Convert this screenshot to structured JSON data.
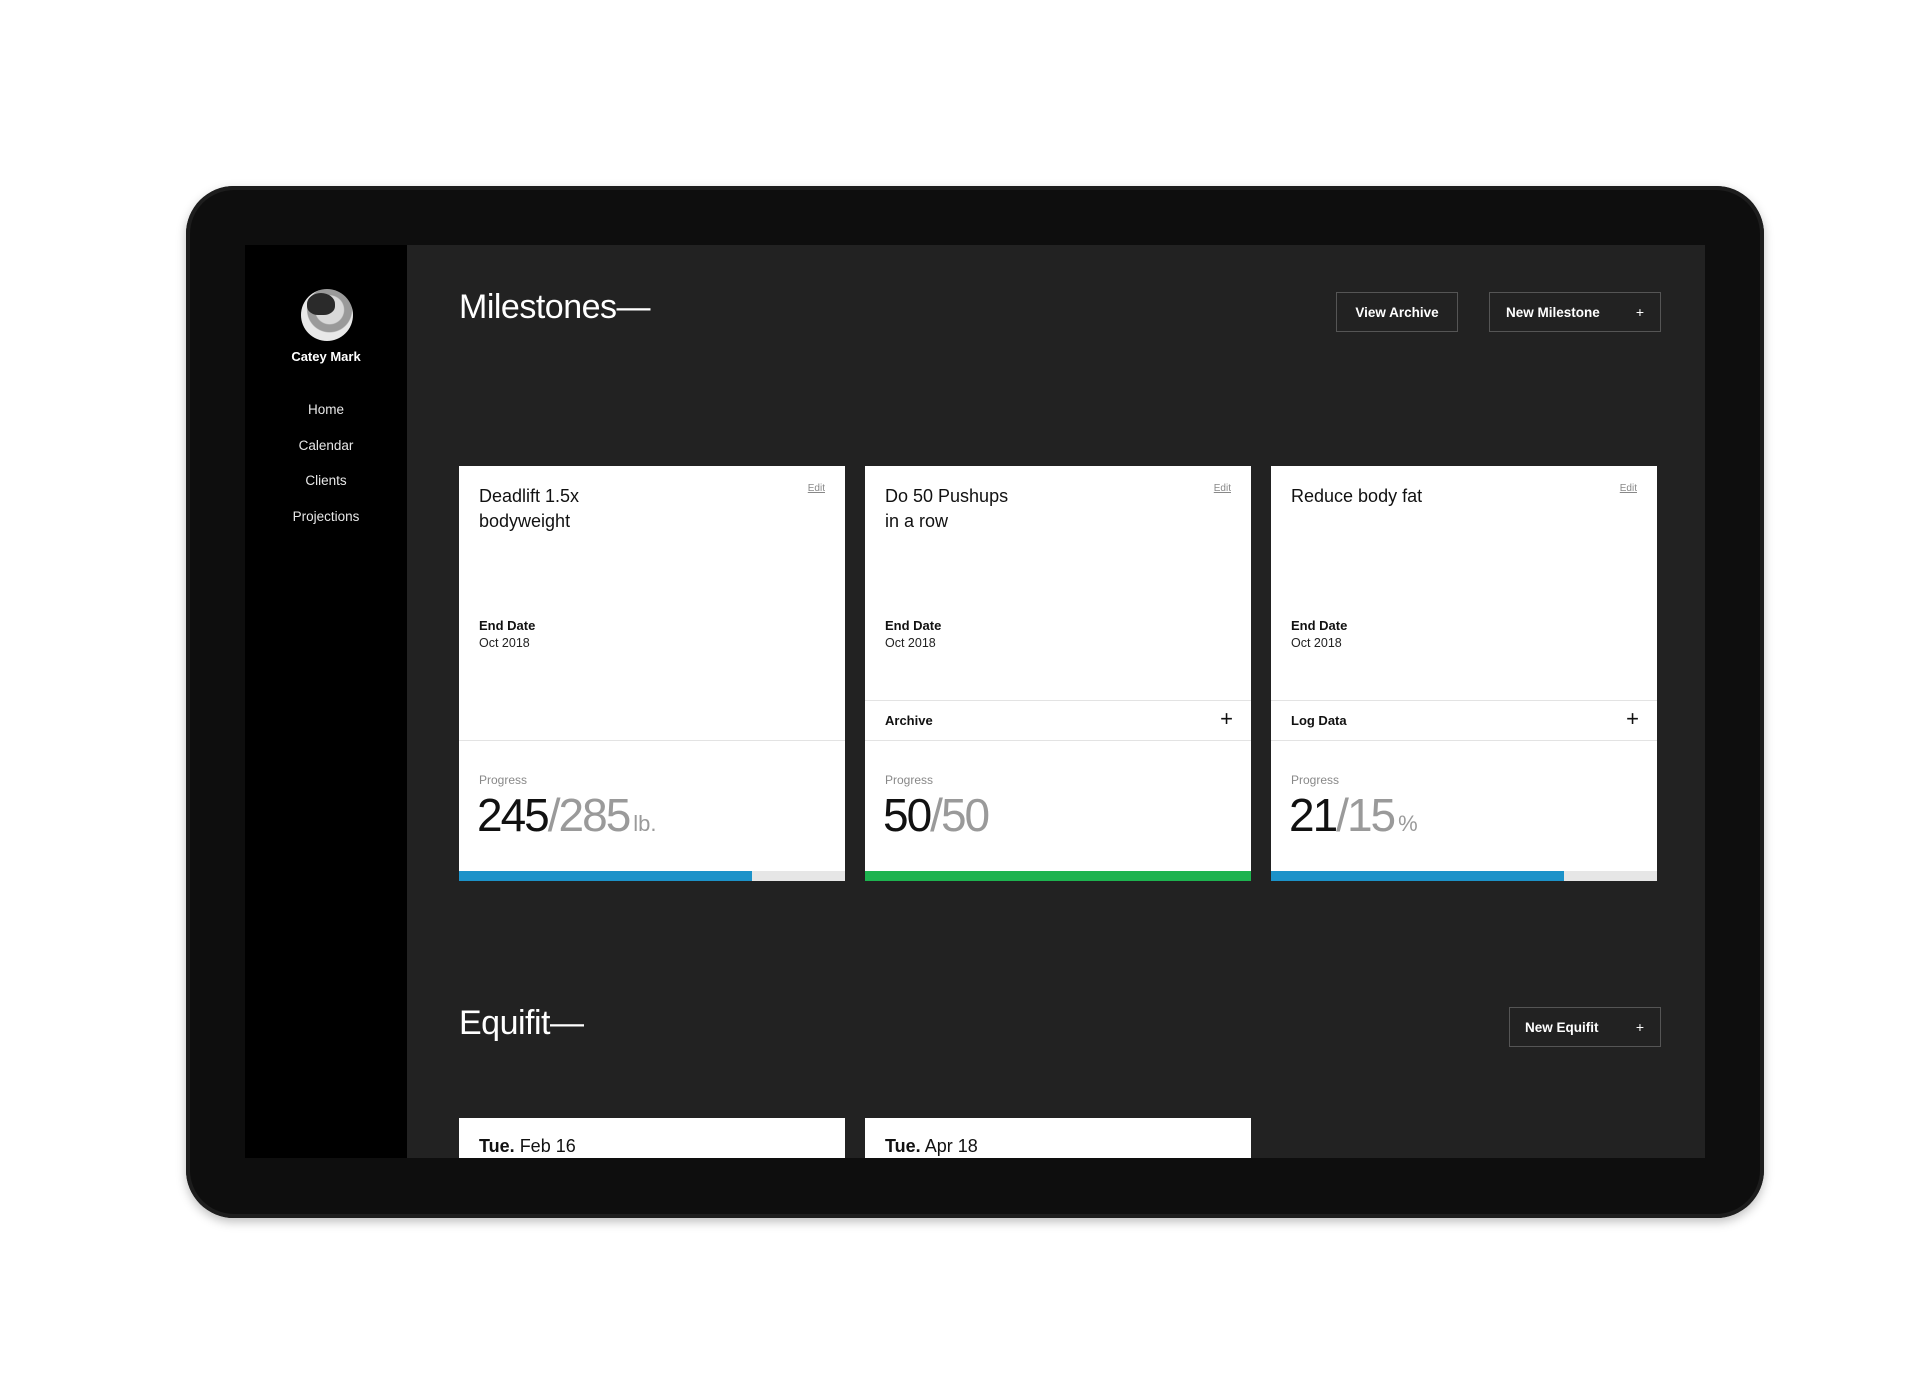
{
  "profile": {
    "name": "Catey Mark"
  },
  "nav": {
    "items": [
      "Home",
      "Calendar",
      "Clients",
      "Projections"
    ]
  },
  "milestones": {
    "title": "Milestones—",
    "view_archive_label": "View Archive",
    "new_label": "New Milestone",
    "new_plus": "+",
    "cards": [
      {
        "title": "Deadlift 1.5x\nbodyweight",
        "edit_label": "Edit",
        "end_label": "End Date",
        "end_value": "Oct 2018",
        "action_label": "",
        "action_plus": "",
        "progress_label": "Progress",
        "current": "245",
        "sep": "/",
        "target": "285",
        "unit": "lb.",
        "progress_fraction": 0.76,
        "bar_color": "#1c92c9"
      },
      {
        "title": "Do 50 Pushups\nin a row",
        "edit_label": "Edit",
        "end_label": "End Date",
        "end_value": "Oct 2018",
        "action_label": "Archive",
        "action_plus": "+",
        "progress_label": "Progress",
        "current": "50",
        "sep": "/",
        "target": "50",
        "unit": "",
        "progress_fraction": 1.0,
        "bar_color": "#1db34f"
      },
      {
        "title": "Reduce body fat",
        "edit_label": "Edit",
        "end_label": "End Date",
        "end_value": "Oct 2018",
        "action_label": "Log Data",
        "action_plus": "+",
        "progress_label": "Progress",
        "current": "21",
        "sep": "/",
        "target": "15",
        "unit": "%",
        "progress_fraction": 0.76,
        "bar_color": "#1c92c9"
      }
    ]
  },
  "equifit": {
    "title": "Equifit—",
    "new_label": "New Equifit",
    "new_plus": "+",
    "cards": [
      {
        "day": "Tue.",
        "date": "Feb 16"
      },
      {
        "day": "Tue.",
        "date": "Apr 18"
      }
    ]
  }
}
